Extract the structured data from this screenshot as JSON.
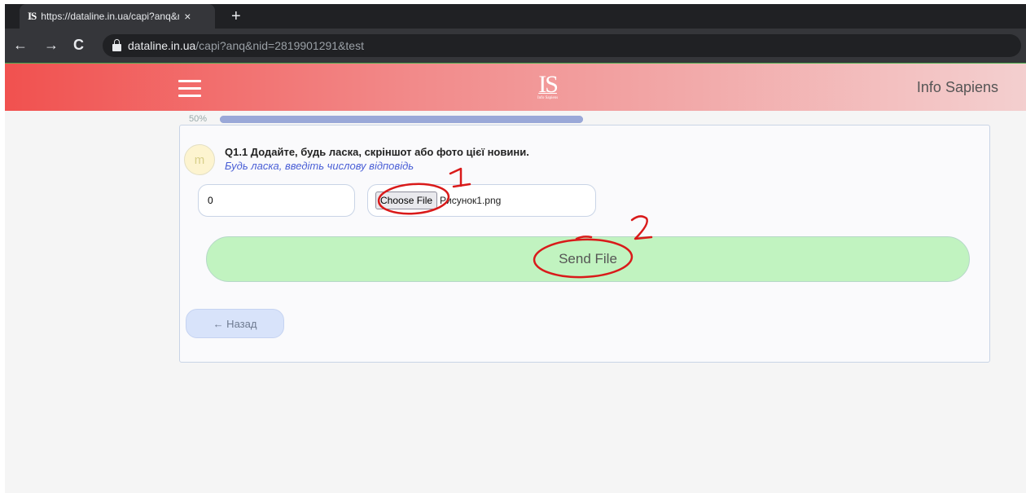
{
  "browser": {
    "tab_favicon": "IS",
    "tab_title": "https://dataline.in.ua/capi?anq&n",
    "tab_close": "×",
    "new_tab": "+",
    "back": "←",
    "forward": "→",
    "reload": "C",
    "url_host": "dataline.in.ua",
    "url_path": "/capi?anq&nid=2819901291&test"
  },
  "header": {
    "logo": "IS",
    "logo_sub": "Info Sapiens",
    "brand": "Info Sapiens"
  },
  "progress": {
    "label": "50%",
    "value": 1.0
  },
  "question": {
    "avatar_letter": "m",
    "text": "Q1.1 Додайте, будь ласка, скріншот або фото цієї новини.",
    "hint": "Будь ласка, введіть числову відповідь",
    "number_value": "0",
    "choose_label": "Choose File",
    "file_name": "Рисунок1.png",
    "send_label": "Send File",
    "back_label": "← Назад"
  },
  "annotations": {
    "mark1": "1",
    "mark2": "2",
    "color": "#d91a1a"
  }
}
